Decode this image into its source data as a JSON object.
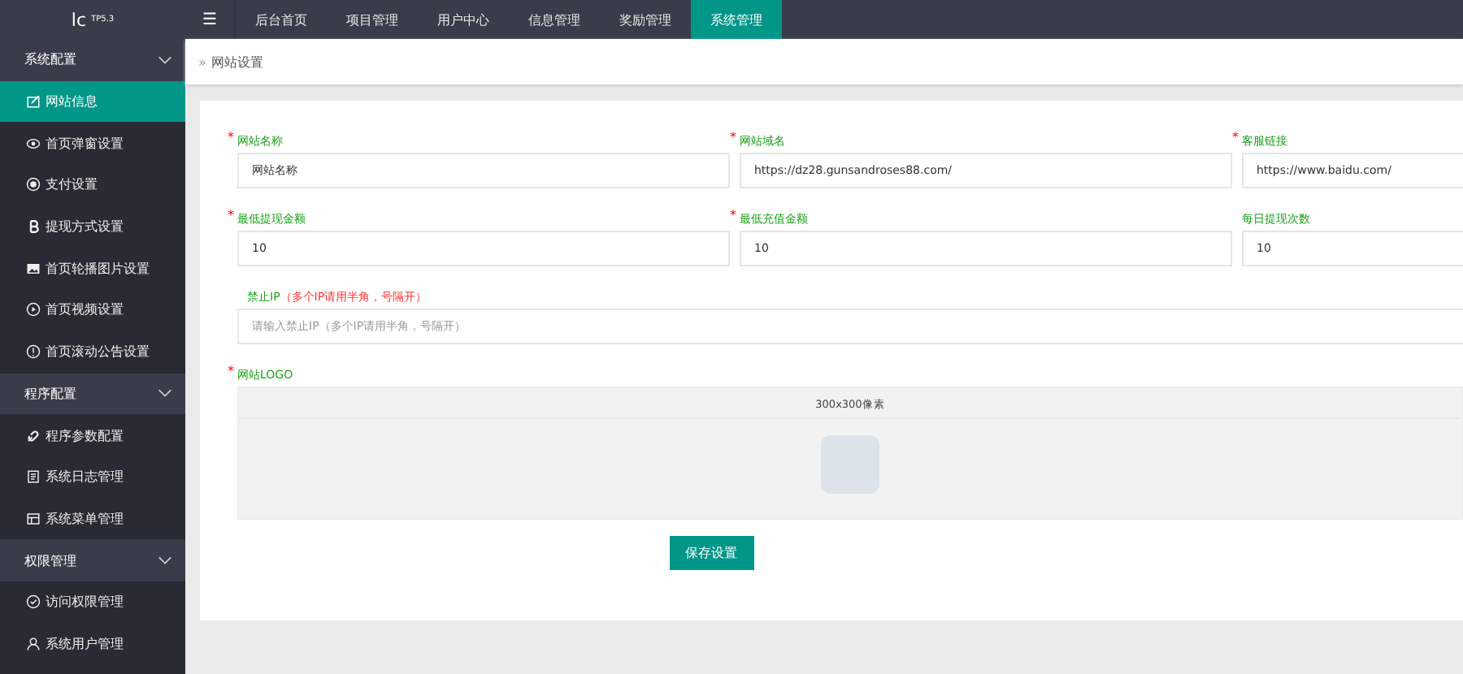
{
  "logo": {
    "text": "lc",
    "version": "TP5.3"
  },
  "menu_toggle": "☰",
  "nav_tabs": [
    {
      "label": "后台首页",
      "selected": false
    },
    {
      "label": "项目管理",
      "selected": false
    },
    {
      "label": "用户中心",
      "selected": false
    },
    {
      "label": "信息管理",
      "selected": false
    },
    {
      "label": "奖励管理",
      "selected": false
    },
    {
      "label": "系统管理",
      "selected": true
    }
  ],
  "sidebar": {
    "groups": [
      {
        "label": "系统配置",
        "expanded": true,
        "items": [
          {
            "label": "网站信息",
            "selected": true
          },
          {
            "label": "首页弹窗设置",
            "selected": false
          },
          {
            "label": "支付设置",
            "selected": false
          },
          {
            "label": "提现方式设置",
            "selected": false
          },
          {
            "label": "首页轮播图片设置",
            "selected": false
          },
          {
            "label": "首页视频设置",
            "selected": false
          },
          {
            "label": "首页滚动公告设置",
            "selected": false
          }
        ]
      },
      {
        "label": "程序配置",
        "expanded": true,
        "items": [
          {
            "label": "程序参数配置",
            "selected": false
          },
          {
            "label": "系统日志管理",
            "selected": false
          },
          {
            "label": "系统菜单管理",
            "selected": false
          }
        ]
      },
      {
        "label": "权限管理",
        "expanded": true,
        "items": [
          {
            "label": "访问权限管理",
            "selected": false
          },
          {
            "label": "系统用户管理",
            "selected": false
          }
        ]
      }
    ]
  },
  "breadcrumb": {
    "separator": "»",
    "current": "网站设置"
  },
  "form": {
    "fields": [
      {
        "kind": "text",
        "label": "网站名称",
        "required_mark": "*",
        "value": "网站名称"
      },
      {
        "kind": "text",
        "label": "网站域名",
        "required_mark": "*",
        "value": "https://dz28.gunsandroses88.com/"
      },
      {
        "kind": "text",
        "label": "客服链接",
        "required_mark": "*",
        "value": "https://www.baidu.com/"
      },
      {
        "kind": "text",
        "label": "最低提现金额",
        "required_mark": "*",
        "value": "10"
      },
      {
        "kind": "text",
        "label": "最低充值金额",
        "required_mark": "*",
        "value": "10"
      },
      {
        "kind": "text",
        "label": "每日提现次数",
        "value": "10"
      },
      {
        "kind": "wide",
        "label": "禁止IP",
        "note": "（多个IP请用半角，号隔开）",
        "placeholder": "请输入禁止IP（多个IP请用半角，号隔开）"
      },
      {
        "kind": "upload",
        "label": "网站LOGO",
        "required_mark": "*",
        "hint": "300x300像素"
      }
    ],
    "submit": "保存设置"
  }
}
